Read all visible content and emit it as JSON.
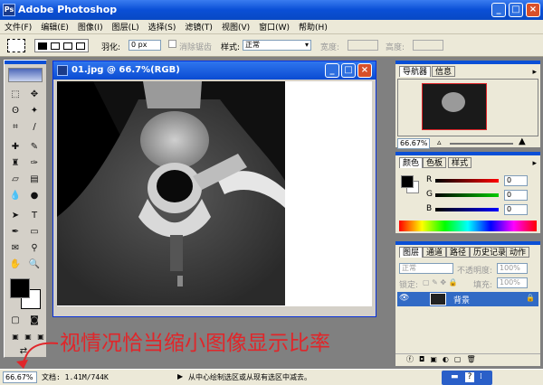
{
  "app": {
    "title": "Adobe Photoshop"
  },
  "menu": [
    "文件(F)",
    "编辑(E)",
    "图像(I)",
    "图层(L)",
    "选择(S)",
    "滤镜(T)",
    "视图(V)",
    "窗口(W)",
    "帮助(H)"
  ],
  "options": {
    "feather_label": "羽化:",
    "feather_value": "0 px",
    "antialias_label": "消除锯齿",
    "style_label": "样式:",
    "style_value": "正常",
    "width_label": "宽度:",
    "height_label": "高度:"
  },
  "document": {
    "title": "01.jpg @ 66.7%(RGB)"
  },
  "navigator": {
    "tabs": [
      "导航器",
      "信息"
    ],
    "zoom": "66.67%"
  },
  "color_panel": {
    "tabs": [
      "颜色",
      "色板",
      "样式"
    ],
    "channels": [
      {
        "label": "R",
        "value": "0"
      },
      {
        "label": "G",
        "value": "0"
      },
      {
        "label": "B",
        "value": "0"
      }
    ]
  },
  "layers_panel": {
    "tabs": [
      "图层",
      "通道",
      "路径",
      "历史记录",
      "动作"
    ],
    "blend_mode": "正常",
    "opacity_label": "不透明度:",
    "opacity_value": "100%",
    "lock_label": "锁定:",
    "fill_label": "填充:",
    "fill_value": "100%",
    "layer_name": "背景"
  },
  "annotation": "视情况恰当缩小图像显示比率",
  "status": {
    "zoom": "66.67%",
    "doc_info": "文档: 1.41M/744K",
    "hint": "从中心绘制选区或从现有选区中减去。"
  },
  "colors": {
    "title_blue": "#0a4fd6",
    "annotation_red": "#e0262a",
    "layer_selected": "#316ac5"
  }
}
